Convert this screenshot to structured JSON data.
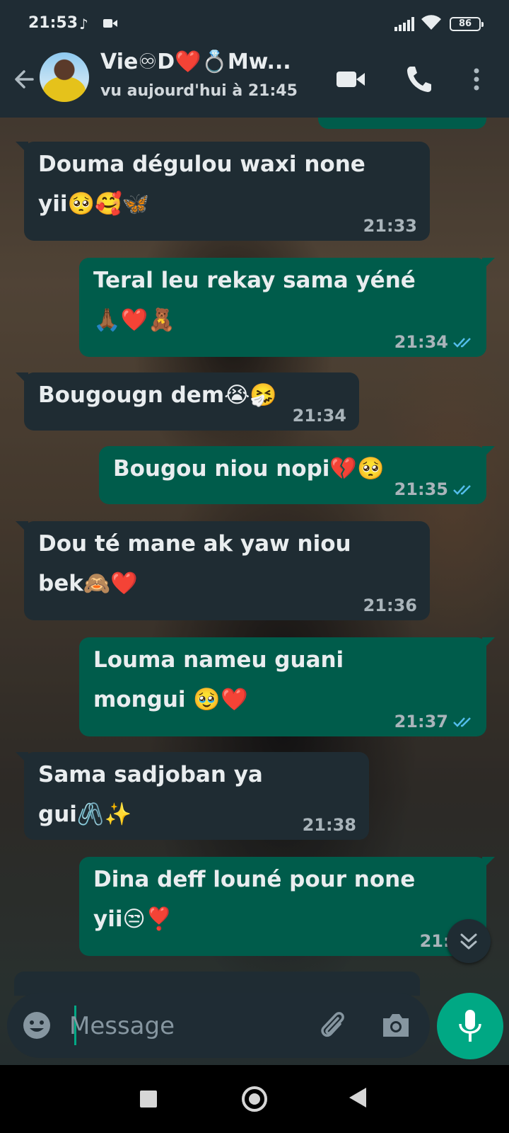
{
  "status_bar": {
    "time": "21:53",
    "battery": "86"
  },
  "header": {
    "contact_name": "Vie♾D❤️💍Mw...",
    "last_seen": "vu aujourd'hui à 21:45"
  },
  "messages": [
    {
      "direction": "in",
      "text": "Douma dégulou waxi none yii🥺🥰🦋",
      "time": "21:33",
      "read": false
    },
    {
      "direction": "out",
      "text": "Teral leu rekay sama yéné🙏🏾❤️🧸",
      "time": "21:34",
      "read": true
    },
    {
      "direction": "in",
      "text": "Bougougn dem😭🤧",
      "time": "21:34",
      "read": false
    },
    {
      "direction": "out",
      "text": "Bougou niou nopi💔🥺",
      "time": "21:35",
      "read": true
    },
    {
      "direction": "in",
      "text": "Dou té mane ak yaw niou bek🙈❤️",
      "time": "21:36",
      "read": false
    },
    {
      "direction": "out",
      "text": "Louma nameu guani mongui 🥹❤️",
      "time": "21:37",
      "read": true
    },
    {
      "direction": "in",
      "text": "Sama sadjoban ya gui🖇️✨",
      "time": "21:38",
      "read": false
    },
    {
      "direction": "out",
      "text": "Dina deff louné pour none yii😒❣️",
      "time": "21:39",
      "read": false
    }
  ],
  "input": {
    "placeholder": "Message"
  },
  "colors": {
    "header_bg": "#1f2c34",
    "incoming_bubble": "#1f2c33",
    "outgoing_bubble": "#005c4b",
    "accent_green": "#00a884",
    "read_ticks": "#53bdeb"
  },
  "icons": [
    "back-arrow-icon",
    "video-call-icon",
    "phone-icon",
    "more-vert-icon",
    "emoji-icon",
    "paperclip-icon",
    "camera-icon",
    "mic-icon",
    "chevron-double-down-icon"
  ]
}
